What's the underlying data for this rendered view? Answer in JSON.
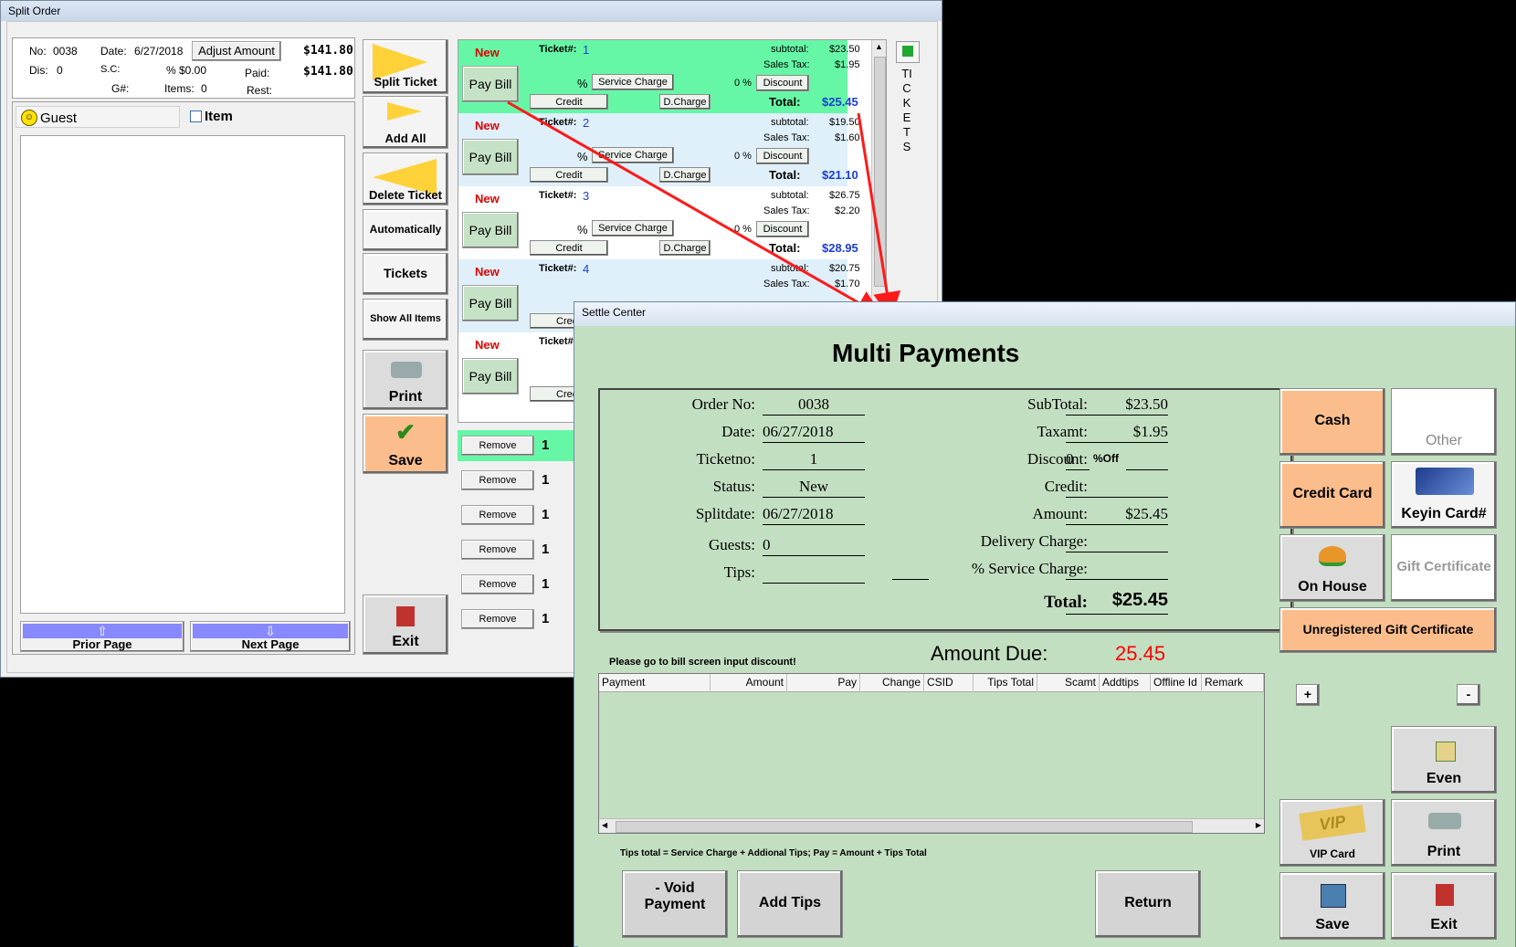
{
  "split_window": {
    "title": "Split Order",
    "header": {
      "no_label": "No:",
      "no_value": "0038",
      "date_label": "Date:",
      "date_value": "6/27/2018",
      "adjust_label": "Adjust Amount",
      "total_value": "$141.80",
      "dis_label": "Dis:",
      "dis_value": "0",
      "sc_label": "S.C:",
      "sc_pct": "%",
      "sc_value": "$0.00",
      "paid_label": "Paid:",
      "paid_value": "$141.80",
      "g_label": "G#:",
      "items_label": "Items:",
      "items_value": "0",
      "rest_label": "Rest:"
    },
    "guest_label": "Guest",
    "item_label": "Item",
    "prior_page": "Prior Page",
    "next_page": "Next Page",
    "actions": {
      "split_ticket": "Split Ticket",
      "add_all": "Add All",
      "delete_ticket": "Delete Ticket",
      "automatically": "Automatically",
      "tickets": "Tickets",
      "show_all_items": "Show All Items",
      "print": "Print",
      "save": "Save",
      "exit": "Exit"
    },
    "tickets_vertical": "TICKETS",
    "tickets": [
      {
        "status": "New",
        "ticket_label": "Ticket#:",
        "number": "1",
        "pay_bill": "Pay Bill",
        "pct": "%",
        "service_charge": "Service Charge",
        "disc_pct": "0 %",
        "discount": "Discount",
        "credit": "Credit",
        "dcharge": "D.Charge",
        "subtotal_label": "subtotal:",
        "subtotal": "$23.50",
        "tax_label": "Sales Tax:",
        "tax": "$1.95",
        "total_label": "Total:",
        "total": "$25.45"
      },
      {
        "status": "New",
        "ticket_label": "Ticket#:",
        "number": "2",
        "pay_bill": "Pay Bill",
        "pct": "%",
        "service_charge": "Service Charge",
        "disc_pct": "0 %",
        "discount": "Discount",
        "credit": "Credit",
        "dcharge": "D.Charge",
        "subtotal_label": "subtotal:",
        "subtotal": "$19.50",
        "tax_label": "Sales Tax:",
        "tax": "$1.60",
        "total_label": "Total:",
        "total": "$21.10"
      },
      {
        "status": "New",
        "ticket_label": "Ticket#:",
        "number": "3",
        "pay_bill": "Pay Bill",
        "pct": "%",
        "service_charge": "Service Charge",
        "disc_pct": "0 %",
        "discount": "Discount",
        "credit": "Credit",
        "dcharge": "D.Charge",
        "subtotal_label": "subtotal:",
        "subtotal": "$26.75",
        "tax_label": "Sales Tax:",
        "tax": "$2.20",
        "total_label": "Total:",
        "total": "$28.95"
      },
      {
        "status": "New",
        "ticket_label": "Ticket#:",
        "number": "4",
        "pay_bill": "Pay Bill",
        "subtotal_label": "subtotal:",
        "subtotal": "$20.75",
        "tax_label": "Sales Tax:",
        "tax": "$1.70",
        "credit": "Cred"
      },
      {
        "status": "New",
        "ticket_label": "Ticket#",
        "pay_bill": "Pay Bill",
        "credit": "Cred"
      }
    ],
    "remove_rows": [
      {
        "label": "Remove",
        "qty": "1"
      },
      {
        "label": "Remove",
        "qty": "1"
      },
      {
        "label": "Remove",
        "qty": "1"
      },
      {
        "label": "Remove",
        "qty": "1"
      },
      {
        "label": "Remove",
        "qty": "1"
      },
      {
        "label": "Remove",
        "qty": "1"
      }
    ]
  },
  "settle_window": {
    "title": "Settle Center",
    "heading": "Multi Payments",
    "left_fields": [
      {
        "label": "Order No:",
        "value": "0038"
      },
      {
        "label": "Date:",
        "value": "06/27/2018"
      },
      {
        "label": "Ticketno:",
        "value": "1"
      },
      {
        "label": "Status:",
        "value": "New"
      },
      {
        "label": "Splitdate:",
        "value": "06/27/2018"
      },
      {
        "label": "Guests:",
        "value": "0"
      },
      {
        "label": "Tips:",
        "value": ""
      }
    ],
    "right_fields": {
      "subtotal_label": "SubTotal:",
      "subtotal": "$23.50",
      "taxamt_label": "Taxamt:",
      "taxamt": "$1.95",
      "discount_label": "Discount:",
      "discount_value": "0",
      "discount_unit": "%Off",
      "credit_label": "Credit:",
      "amount_label": "Amount:",
      "amount": "$25.45",
      "delivery_label": "Delivery Charge:",
      "service_label": "% Service Charge:",
      "total_label": "Total:",
      "total": "$25.45"
    },
    "amount_due_label": "Amount Due:",
    "amount_due": "25.45",
    "discount_notice": "Please go to bill screen input discount!",
    "columns": [
      "Payment",
      "Amount",
      "Pay",
      "Change",
      "CSID",
      "Tips Total",
      "Scamt",
      "Addtips",
      "Offline Id",
      "Remark"
    ],
    "tips_note": "Tips total = Service Charge + Addional Tips;  Pay = Amount + Tips Total",
    "buttons": {
      "void_payment": "- Void Payment",
      "add_tips": "Add Tips",
      "return": "Return",
      "cash": "Cash",
      "other": "Other",
      "credit_card": "Credit Card",
      "keyin_card": "Keyin Card#",
      "on_house": "On House",
      "gift_certificate": "Gift Certificate",
      "unregistered_gift": "Unregistered Gift Certificate",
      "plus": "+",
      "minus": "-",
      "even": "Even",
      "vip_card": "VIP Card",
      "print": "Print",
      "save": "Save",
      "exit": "Exit"
    },
    "colors": {
      "bg": "#c3dfc1",
      "cash": "#fbbd8b",
      "due_red": "#ff0000"
    }
  }
}
